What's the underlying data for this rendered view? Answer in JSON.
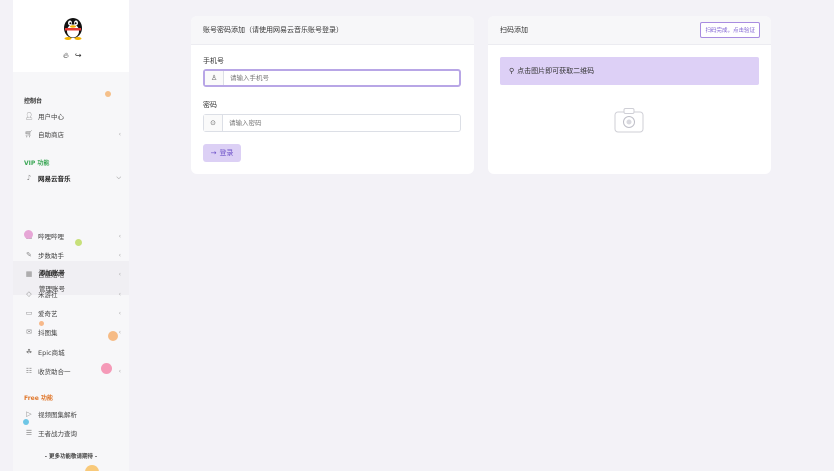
{
  "sidebar": {
    "profile": {
      "avatar_icon": "qq-penguin-icon",
      "icons": [
        "fire-icon",
        "logout-icon"
      ]
    },
    "sections": {
      "console": "控制台",
      "vip": "VIP 功能",
      "free": "Free 功能"
    },
    "items": {
      "user_center": "用户中心",
      "self_shop": "自助商店",
      "netease": "网易云音乐",
      "add_account": "添加账号",
      "manage_account": "管理账号",
      "bilibili": "哔哩哔哩",
      "step": "步数助手",
      "tieba": "百度贴吧",
      "miyoushe": "米游社",
      "iqiyi": "爱奇艺",
      "tiktok": "抖图集",
      "epic": "Epic商城",
      "collect": "收货助合一",
      "video_parse": "视频图集解析",
      "wzry": "王者战力查询"
    },
    "more": "- 更多功能敬请期待 -",
    "colors": {
      "vip_title": "#3aa655",
      "free_title": "#e0772b",
      "accent": "#7a5ad0"
    }
  },
  "login_card": {
    "title": "账号密码添加（请使用网易云音乐账号登录）",
    "phone_label": "手机号",
    "phone_placeholder": "请输入手机号",
    "password_label": "密码",
    "password_placeholder": "请输入密码",
    "login_button": "登录"
  },
  "qr_card": {
    "title": "扫码添加",
    "verify_button": "扫码完成，点击验证",
    "hint": "点击图片即可获取二维码"
  }
}
